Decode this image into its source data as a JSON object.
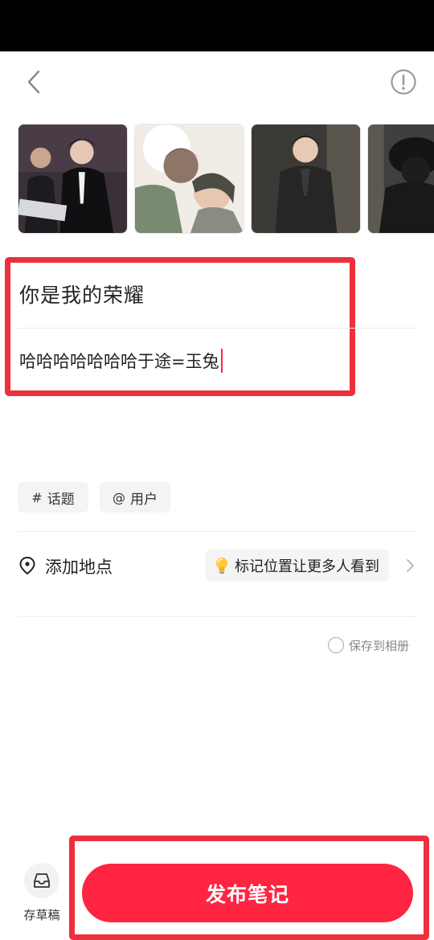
{
  "editor": {
    "title": "你是我的荣耀",
    "body": "哈哈哈哈哈哈哈于途=玉兔"
  },
  "chips": {
    "topic_symbol": "#",
    "topic_label": "话题",
    "user_symbol": "@",
    "user_label": "用户"
  },
  "location": {
    "label": "添加地点",
    "hint": "标记位置让更多人看到"
  },
  "save_album": {
    "label": "保存到相册",
    "checked": false
  },
  "footer": {
    "draft_label": "存草稿",
    "publish_label": "发布笔记"
  },
  "icons": [
    "back-chevron-icon",
    "info-icon",
    "location-pin-icon",
    "lightbulb-icon",
    "chevron-right-icon",
    "inbox-tray-icon"
  ],
  "colors": {
    "accent": "#ff2442",
    "annotation_frame": "#ee2f3c",
    "chip_bg": "#f4f4f4"
  }
}
